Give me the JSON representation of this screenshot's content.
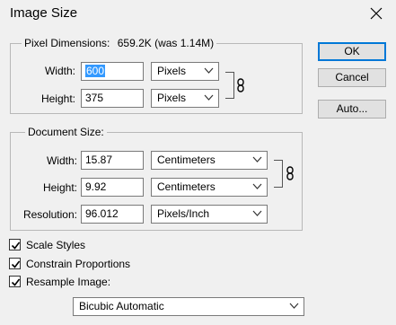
{
  "dialog": {
    "title": "Image Size",
    "close_icon": "close-icon"
  },
  "pixel_dimensions": {
    "legend": "Pixel Dimensions:",
    "size": "659.2K (was 1.14M)",
    "width_label": "Width:",
    "width_value_selected": "600",
    "width_unit": "Pixels",
    "height_label": "Height:",
    "height_value": "375",
    "height_unit": "Pixels",
    "link_icon": "chain-link-icon"
  },
  "document_size": {
    "legend": "Document Size:",
    "width_label": "Width:",
    "width_value": "15.87",
    "width_unit": "Centimeters",
    "height_label": "Height:",
    "height_value": "9.92",
    "height_unit": "Centimeters",
    "resolution_label": "Resolution:",
    "resolution_value": "96.012",
    "resolution_unit": "Pixels/Inch",
    "link_icon": "chain-link-icon"
  },
  "options": {
    "scale_styles": {
      "label": "Scale Styles",
      "checked": true
    },
    "constrain_proportions": {
      "label": "Constrain Proportions",
      "checked": true
    },
    "resample_image": {
      "label": "Resample Image:",
      "checked": true
    },
    "resample_method": "Bicubic Automatic"
  },
  "buttons": {
    "ok": "OK",
    "cancel": "Cancel",
    "auto": "Auto..."
  },
  "colors": {
    "background": "#f0f0f0",
    "selection": "#3399ff",
    "default_button_border": "#0078d7"
  }
}
